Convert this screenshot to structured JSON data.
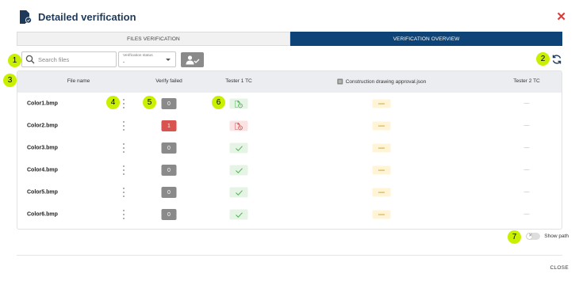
{
  "dialog": {
    "title": "Detailed verification",
    "close_icon": "close-icon"
  },
  "tabs": [
    {
      "label": "FILES VERIFICATION",
      "active": false
    },
    {
      "label": "VERIFICATION OVERVIEW",
      "active": true
    }
  ],
  "toolbar": {
    "search_placeholder": "Search files",
    "status_label": "Verification status",
    "status_value": "-",
    "assign_icon": "user-check-icon",
    "refresh_icon": "refresh-icon"
  },
  "table": {
    "columns": {
      "file_name": "File name",
      "verify_failed": "Verify failed",
      "tester1": "Tester 1 TC",
      "json": "Construction drawing approval.json",
      "tester2": "Tester 2 TC"
    },
    "rows": [
      {
        "name": "Color1.bmp",
        "failed": "0",
        "failed_status": "neutral",
        "tester1": "pending",
        "json": "—",
        "tester2": "—"
      },
      {
        "name": "Color2.bmp",
        "failed": "1",
        "failed_status": "failed",
        "tester1": "failed",
        "json": "—",
        "tester2": "—"
      },
      {
        "name": "Color3.bmp",
        "failed": "0",
        "failed_status": "neutral",
        "tester1": "verified",
        "json": "—",
        "tester2": "—"
      },
      {
        "name": "Color4.bmp",
        "failed": "0",
        "failed_status": "neutral",
        "tester1": "verified",
        "json": "—",
        "tester2": "—"
      },
      {
        "name": "Color5.bmp",
        "failed": "0",
        "failed_status": "neutral",
        "tester1": "verified",
        "json": "—",
        "tester2": "—"
      },
      {
        "name": "Color6.bmp",
        "failed": "0",
        "failed_status": "neutral",
        "tester1": "verified",
        "json": "—",
        "tester2": "—"
      }
    ]
  },
  "annotations": [
    "1",
    "2",
    "3",
    "4",
    "5",
    "6",
    "7"
  ],
  "footer": {
    "show_path_label": "Show path",
    "show_path_enabled": false,
    "close_label": "CLOSE"
  },
  "colors": {
    "brand": "#0e4377",
    "failed": "#d9534f",
    "neutral_count": "#8a8a8a",
    "verified": "#4caf50",
    "pending_dash": "#cc9a06",
    "badge": "#c9f000",
    "close_x": "#d63b3b"
  }
}
